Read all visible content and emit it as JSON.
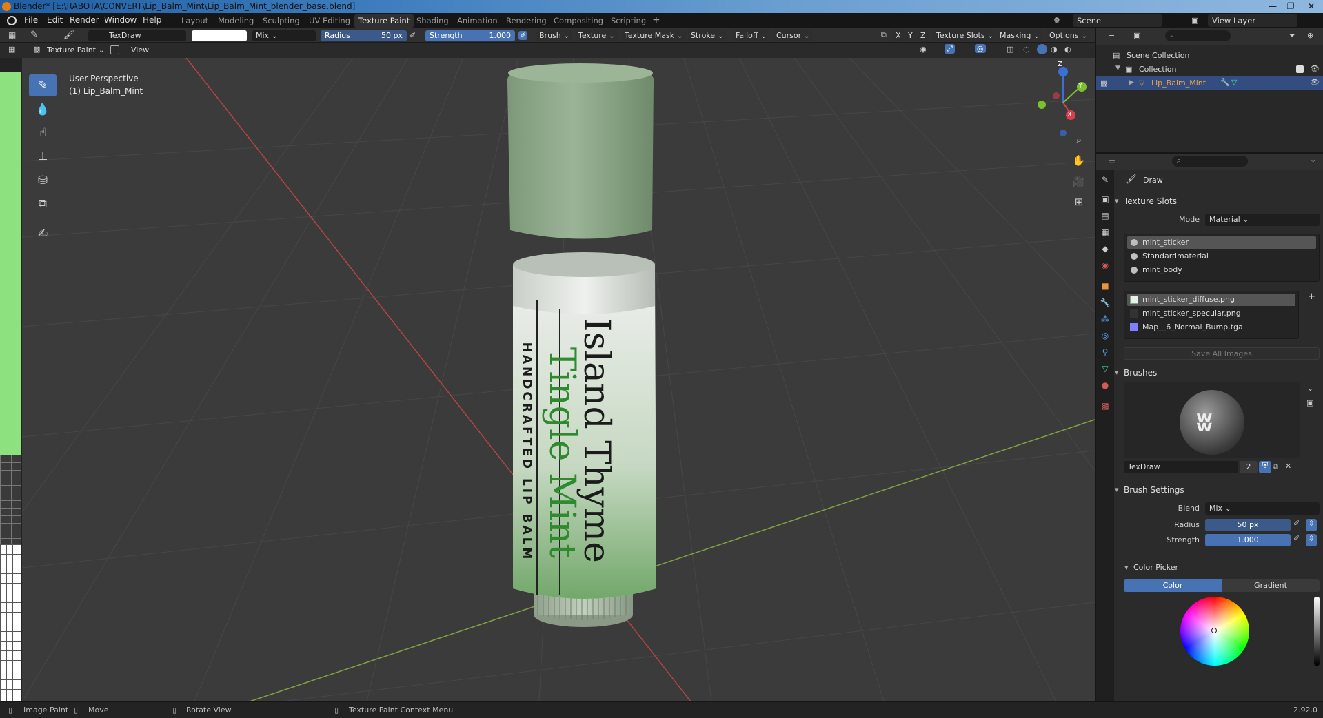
{
  "window": {
    "title": "Blender* [E:\\RABOTA\\CONVERT\\Lip_Balm_Mint\\Lip_Balm_Mint_blender_base.blend]",
    "minimize": "—",
    "maximize": "❐",
    "close": "✕"
  },
  "menu": [
    "File",
    "Edit",
    "Render",
    "Window",
    "Help"
  ],
  "workspaces": [
    "Layout",
    "Modeling",
    "Sculpting",
    "UV Editing",
    "Texture Paint",
    "Shading",
    "Animation",
    "Rendering",
    "Compositing",
    "Scripting"
  ],
  "active_workspace": "Texture Paint",
  "add_workspace": "+",
  "scene": {
    "name": "Scene",
    "view_layer": "View Layer"
  },
  "toolheader": {
    "brush_name": "TexDraw",
    "blend": "Mix",
    "radius_label": "Radius",
    "radius_value": "50 px",
    "strength_label": "Strength",
    "strength_value": "1.000",
    "menus": [
      "Brush",
      "Texture",
      "Texture Mask",
      "Stroke",
      "Falloff",
      "Cursor"
    ],
    "axes": [
      "X",
      "Y",
      "Z"
    ],
    "right_menus": [
      "Texture Slots",
      "Masking",
      "Options"
    ]
  },
  "viewheader": {
    "mode": "Texture Paint",
    "view": "View"
  },
  "viewport": {
    "perspective": "User Perspective",
    "object": "(1) Lip_Balm_Mint",
    "label_line1": "Island Thyme",
    "label_line2": "Tingle Mint",
    "label_line3": "HANDCRAFTED LIP BALM",
    "gizmo": {
      "x": "X",
      "y": "Y",
      "z": "Z"
    }
  },
  "outliner": {
    "scene_collection": "Scene Collection",
    "collection": "Collection",
    "object": "Lip_Balm_Mint"
  },
  "properties": {
    "tool_name": "Draw",
    "texture_slots": {
      "title": "Texture Slots",
      "mode_label": "Mode",
      "mode_value": "Material",
      "materials": [
        "mint_sticker",
        "Standardmaterial",
        "mint_body"
      ],
      "images": [
        "mint_sticker_diffuse.png",
        "mint_sticker_specular.png",
        "Map__6_Normal_Bump.tga"
      ],
      "save_all": "Save All Images"
    },
    "brushes": {
      "title": "Brushes",
      "brush_name": "TexDraw",
      "users": "2"
    },
    "brush_settings": {
      "title": "Brush Settings",
      "blend_label": "Blend",
      "blend_value": "Mix",
      "radius_label": "Radius",
      "radius_value": "50 px",
      "strength_label": "Strength",
      "strength_value": "1.000"
    },
    "color_picker": {
      "title": "Color Picker",
      "tab_color": "Color",
      "tab_gradient": "Gradient"
    }
  },
  "statusbar": {
    "image_paint": "Image Paint",
    "move": "Move",
    "rotate": "Rotate View",
    "context": "Texture Paint Context Menu",
    "version": "2.92.0"
  },
  "colors": {
    "accent": "#4772b3",
    "tube_green": "#8aa886",
    "label_green": "#2d8a2d"
  }
}
